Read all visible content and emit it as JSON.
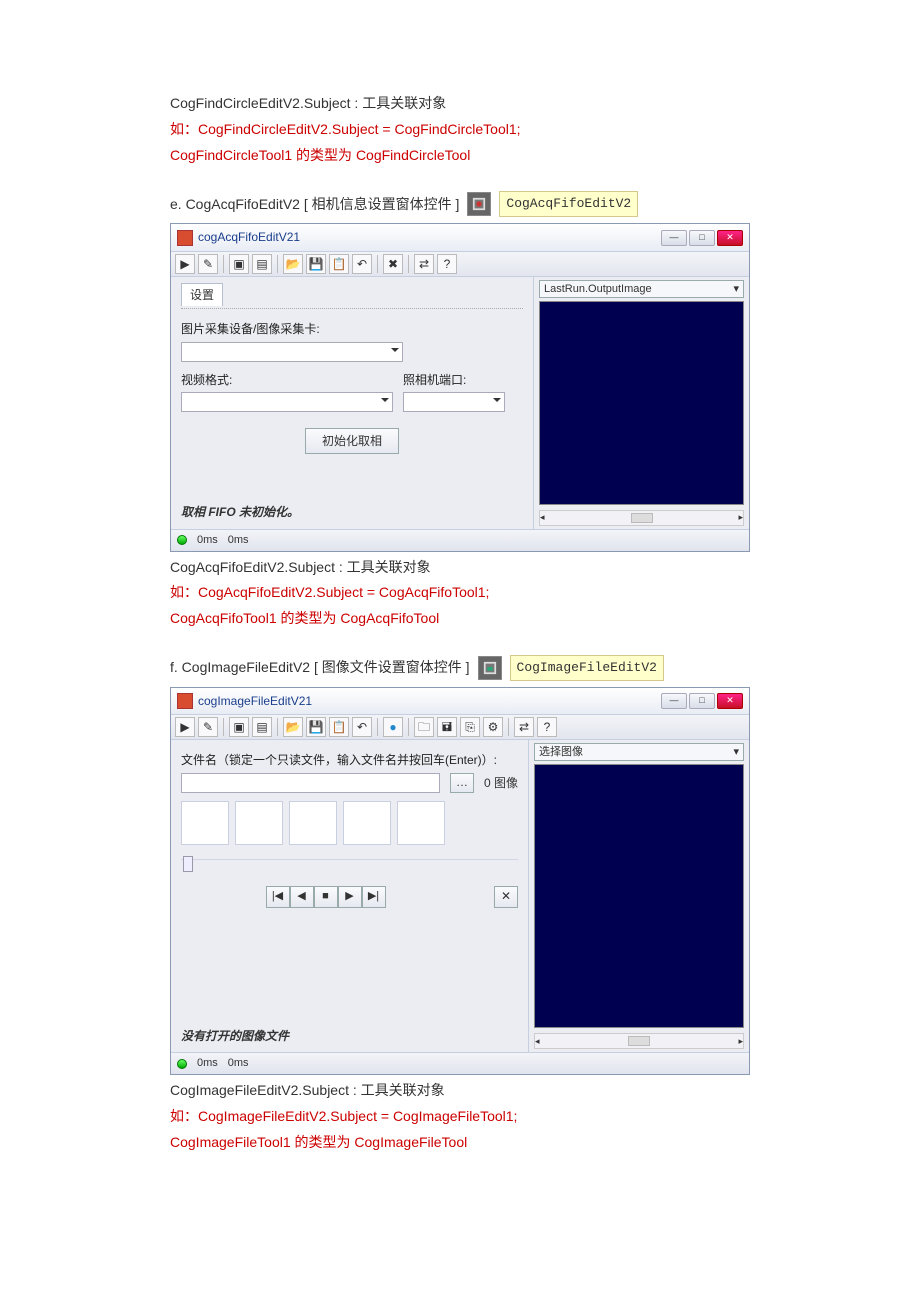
{
  "sectA": {
    "line1": "CogFindCircleEditV2.Subject : 工具关联对象",
    "line2": "如：CogFindCircleEditV2.Subject = CogFindCircleTool1;",
    "line3": "CogFindCircleTool1 的类型为 CogFindCircleTool"
  },
  "sectE": {
    "heading": "e. CogAcqFifoEditV2  [ 相机信息设置窗体控件 ]",
    "label": "CogAcqFifoEditV2",
    "desc1": "CogAcqFifoEditV2.Subject : 工具关联对象",
    "desc2": "如：CogAcqFifoEditV2.Subject = CogAcqFifoTool1;",
    "desc3": "CogAcqFifoTool1 的类型为 CogAcqFifoTool"
  },
  "win1": {
    "title": "cogAcqFifoEditV21",
    "tab": "设置",
    "grp1": "图片采集设备/图像采集卡:",
    "grp2": "视频格式:",
    "grp3": "照相机端口:",
    "initBtn": "初始化取相",
    "statusMsg": "取相 FIFO 未初始化。",
    "rightCombo": "LastRun.OutputImage",
    "timing1": "0ms",
    "timing2": "0ms"
  },
  "sectF": {
    "heading": "f. CogImageFileEditV2 [ 图像文件设置窗体控件 ]",
    "label": "CogImageFileEditV2",
    "desc1": "CogImageFileEditV2.Subject : 工具关联对象",
    "desc2": "如：CogImageFileEditV2.Subject = CogImageFileTool1;",
    "desc3": "CogImageFileTool1 的类型为 CogImageFileTool"
  },
  "win2": {
    "title": "cogImageFileEditV21",
    "fileLabel": "文件名（锁定一个只读文件，输入文件名并按回车(Enter)）:",
    "countLabel": "0 图像",
    "statusMsg": "没有打开的图像文件",
    "rightCombo": "选择图像",
    "nav_first": "|◀",
    "nav_prev": "◀",
    "nav_stop": "■",
    "nav_next": "▶",
    "nav_last": "▶|",
    "close_x": "✕",
    "timing1": "0ms",
    "timing2": "0ms"
  }
}
